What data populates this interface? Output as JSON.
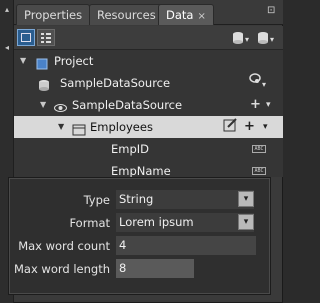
{
  "tabs": [
    {
      "label": "Properties",
      "active": false
    },
    {
      "label": "Resources",
      "active": false
    },
    {
      "label": "Data",
      "active": true
    }
  ],
  "tab_close_glyph": "×",
  "pin_glyph": "⊡",
  "tree": {
    "project_label": "Project",
    "datasource_label": "SampleDataSource",
    "datasource_child_label": "SampleDataSource",
    "collection_label": "Employees",
    "fields": [
      {
        "label": "EmpID",
        "type_icon": "ABC"
      },
      {
        "label": "EmpName",
        "type_icon": "ABC"
      }
    ],
    "add_glyph": "+",
    "dropdown_glyph": "▾"
  },
  "properties": {
    "type_label": "Type",
    "type_value": "String",
    "format_label": "Format",
    "format_value": "Lorem ipsum",
    "max_word_count_label": "Max word count",
    "max_word_count_value": "4",
    "max_word_length_label": "Max word length",
    "max_word_length_value": "8",
    "dropdown_glyph": "▾"
  },
  "colors": {
    "selected_row": "#d9d9d9",
    "active_mode": "#2a5d8f",
    "panel_bg": "#353535"
  }
}
